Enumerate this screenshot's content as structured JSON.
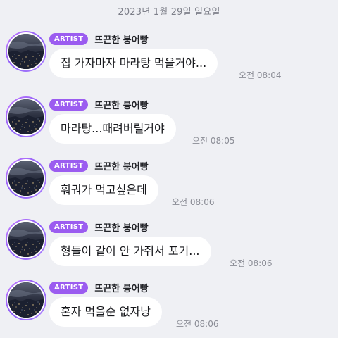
{
  "date_header": "2023년 1월 29일 일요일",
  "badge_text": "ARTIST",
  "sender_name": "뜨끈한 붕어빵",
  "messages": [
    {
      "text": "집 가자마자 마라탕 먹을거야...",
      "time": "오전 08:04"
    },
    {
      "text": "마라탕...때려버릴거야",
      "time": "오전 08:05"
    },
    {
      "text": "훠궈가 먹고싶은데",
      "time": "오전 08:06"
    },
    {
      "text": "형들이 같이 안 가줘서 포기...",
      "time": "오전 08:06"
    },
    {
      "text": "혼자 먹을순 없자낭",
      "time": "오전 08:06"
    }
  ],
  "colors": {
    "background": "#eff0f4",
    "badge": "#9b5cf0",
    "bubble": "#ffffff",
    "timestamp": "#8a8c95"
  }
}
